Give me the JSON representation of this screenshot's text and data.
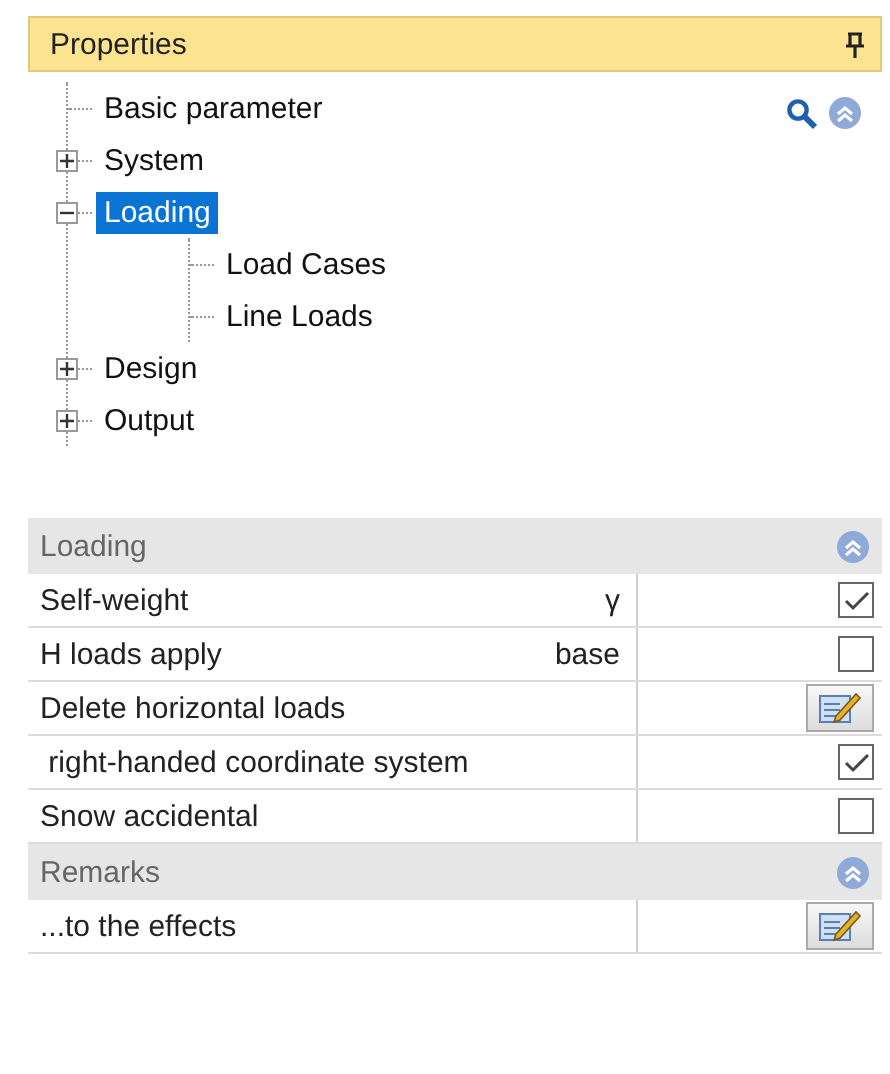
{
  "panel": {
    "title": "Properties"
  },
  "tree": [
    {
      "label": "Basic parameter",
      "selected": false
    },
    {
      "label": "System",
      "selected": false,
      "expanded": false
    },
    {
      "label": "Loading",
      "selected": true,
      "expanded": true,
      "children": [
        {
          "label": "Load Cases",
          "selected": false
        },
        {
          "label": "Line Loads",
          "selected": false
        }
      ]
    },
    {
      "label": "Design",
      "selected": false,
      "expanded": false
    },
    {
      "label": "Output",
      "selected": false,
      "expanded": false
    }
  ],
  "sections": [
    {
      "title": "Loading",
      "rows": [
        {
          "label": "Self-weight",
          "unit": "γ",
          "kind": "checkbox",
          "checked": true
        },
        {
          "label": "H loads apply",
          "unit": "base",
          "kind": "checkbox",
          "checked": false
        },
        {
          "label": "Delete horizontal loads",
          "kind": "button"
        },
        {
          "label": " right-handed coordinate system",
          "kind": "checkbox",
          "checked": true
        },
        {
          "label": "Snow accidental",
          "kind": "checkbox",
          "checked": false
        }
      ]
    },
    {
      "title": "Remarks",
      "rows": [
        {
          "label": "...to the effects",
          "kind": "button"
        }
      ]
    }
  ]
}
